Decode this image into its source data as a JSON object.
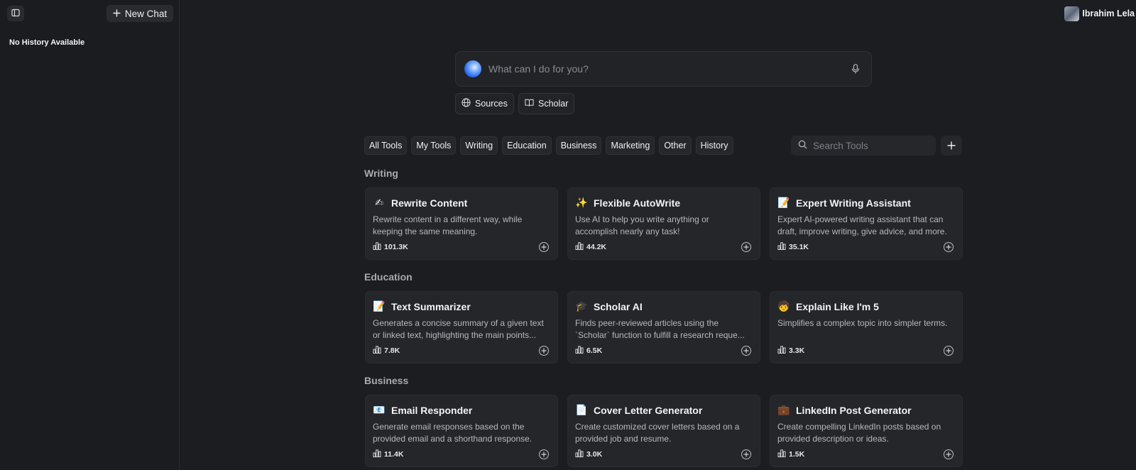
{
  "sidebar": {
    "new_chat_label": "New Chat",
    "empty_history": "No History Available"
  },
  "user": {
    "name": "Ibrahim Lela"
  },
  "prompt": {
    "placeholder": "What can I do for you?"
  },
  "chips": [
    {
      "label": "Sources",
      "icon": "globe-icon"
    },
    {
      "label": "Scholar",
      "icon": "book-icon"
    }
  ],
  "tabs": [
    "All Tools",
    "My Tools",
    "Writing",
    "Education",
    "Business",
    "Marketing",
    "Other",
    "History"
  ],
  "tool_search": {
    "placeholder": "Search Tools"
  },
  "sections": [
    {
      "title": "Writing",
      "cards": [
        {
          "emoji": "✍",
          "title": "Rewrite Content",
          "desc": "Rewrite content in a different way, while keeping the same meaning.",
          "count": "101.3K"
        },
        {
          "emoji": "✨",
          "title": "Flexible AutoWrite",
          "desc": "Use AI to help you write anything or accomplish nearly any task!",
          "count": "44.2K"
        },
        {
          "emoji": "📝",
          "title": "Expert Writing Assistant",
          "desc": "Expert AI-powered writing assistant that can draft, improve writing, give advice, and more.",
          "count": "35.1K"
        }
      ]
    },
    {
      "title": "Education",
      "cards": [
        {
          "emoji": "📝",
          "title": "Text Summarizer",
          "desc": "Generates a concise summary of a given text or linked text, highlighting the main points...",
          "count": "7.8K"
        },
        {
          "emoji": "🎓",
          "title": "Scholar AI",
          "desc": "Finds peer-reviewed articles using the `Scholar` function to fulfill a research reque...",
          "count": "6.5K"
        },
        {
          "emoji": "🧒",
          "title": "Explain Like I'm 5",
          "desc": "Simplifies a complex topic into simpler terms.",
          "count": "3.3K"
        }
      ]
    },
    {
      "title": "Business",
      "cards": [
        {
          "emoji": "📧",
          "title": "Email Responder",
          "desc": "Generate email responses based on the provided email and a shorthand response.",
          "count": "11.4K"
        },
        {
          "emoji": "📄",
          "title": "Cover Letter Generator",
          "desc": "Create customized cover letters based on a provided job and resume.",
          "count": "3.0K"
        },
        {
          "emoji": "💼",
          "title": "LinkedIn Post Generator",
          "desc": "Create compelling LinkedIn posts based on provided description or ideas.",
          "count": "1.5K"
        }
      ]
    }
  ]
}
